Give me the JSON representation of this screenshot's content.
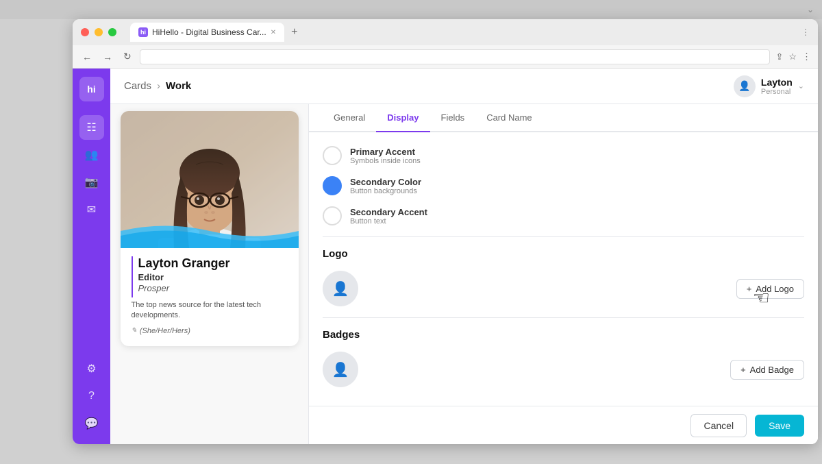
{
  "browser": {
    "tab_title": "HiHello - Digital Business Car...",
    "tab_favicon": "hi"
  },
  "breadcrumb": {
    "parent": "Cards",
    "current": "Work"
  },
  "user": {
    "name": "Layton",
    "role": "Personal"
  },
  "tabs": {
    "items": [
      "General",
      "Display",
      "Fields",
      "Card Name"
    ],
    "active": "Display"
  },
  "display_options": {
    "primary_accent": {
      "label": "Primary Accent",
      "sublabel": "Symbols inside icons",
      "color": "empty"
    },
    "secondary_color": {
      "label": "Secondary Color",
      "sublabel": "Button backgrounds",
      "color": "blue"
    },
    "secondary_accent": {
      "label": "Secondary Accent",
      "sublabel": "Button text",
      "color": "empty"
    }
  },
  "logo_section": {
    "title": "Logo",
    "add_btn_label": "Add Logo"
  },
  "badges_section": {
    "title": "Badges",
    "add_btn_label": "Add Badge"
  },
  "footer": {
    "cancel_label": "Cancel",
    "save_label": "Save"
  },
  "card": {
    "name": "Layton Granger",
    "title": "Editor",
    "company": "Prosper",
    "description": "The top news source for the latest tech developments.",
    "pronouns": "(She/Her/Hers)"
  },
  "sidebar": {
    "logo": "hi",
    "items": [
      "cards",
      "contacts",
      "gallery",
      "mail",
      "settings",
      "help",
      "chat"
    ]
  }
}
